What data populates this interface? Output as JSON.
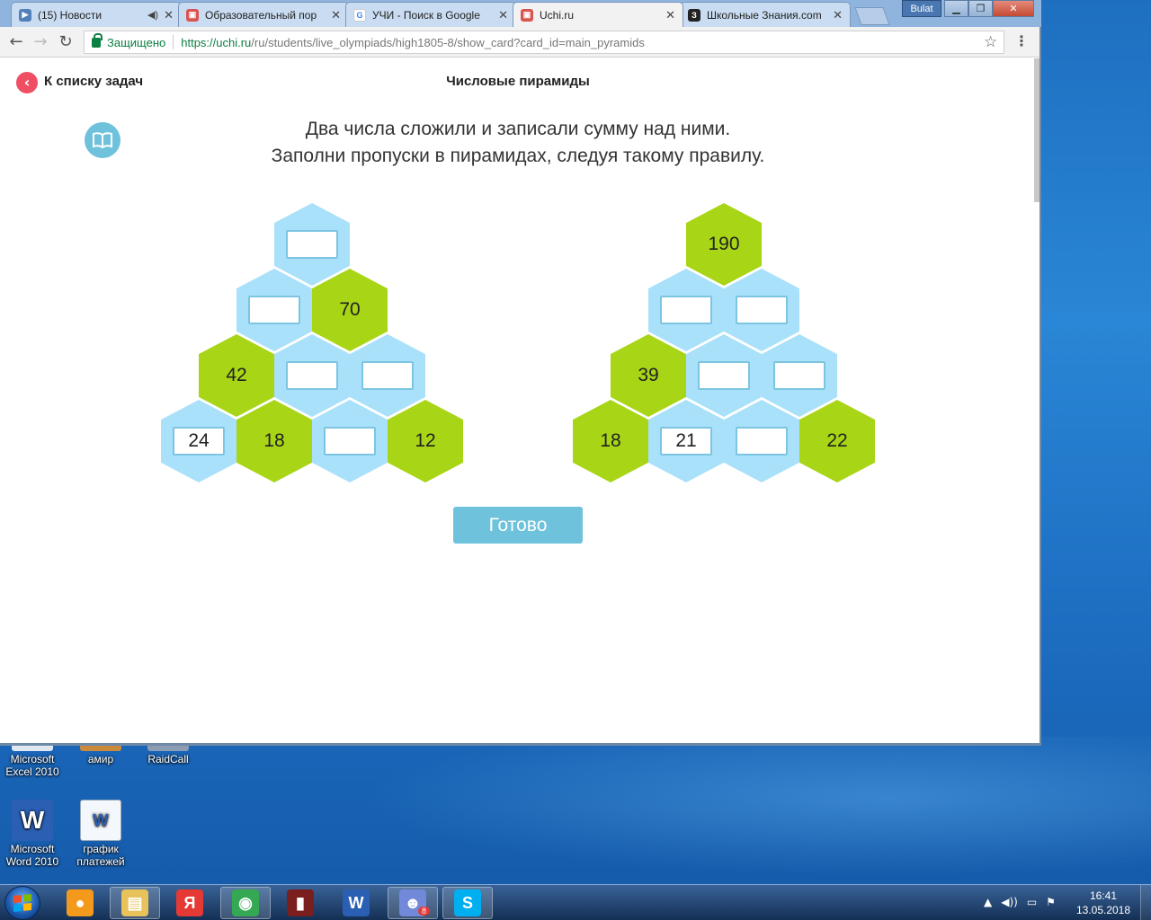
{
  "browser": {
    "tabs": [
      {
        "title": "(15) Новости",
        "favicon_color": "#5181b8",
        "favicon_glyph": "▶"
      },
      {
        "title": "Образовательный пор",
        "favicon_color": "#d9534f",
        "favicon_glyph": "▣"
      },
      {
        "title": "УЧИ - Поиск в Google",
        "favicon_color": "#4285f4",
        "favicon_glyph": "G"
      },
      {
        "title": "Uchi.ru",
        "favicon_color": "#d9534f",
        "favicon_glyph": "▣"
      },
      {
        "title": "Школьные Знания.com",
        "favicon_color": "#222222",
        "favicon_glyph": "З"
      }
    ],
    "user_button": "Bulat",
    "secure_label": "Защищено",
    "url_host": "https://uchi.ru",
    "url_path": "/ru/students/live_olympiads/high1805-8/show_card?card_id=main_pyramids"
  },
  "page": {
    "back_label": "К списку задач",
    "title": "Числовые пирамиды",
    "instruction_line1": "Два числа сложили и записали сумму над ними.",
    "instruction_line2": "Заполни пропуски в пирамидах, следуя такому правилу.",
    "done_button": "Готово"
  },
  "pyramids": [
    {
      "rows": [
        [
          {
            "value": "",
            "kind": "input"
          }
        ],
        [
          {
            "value": "",
            "kind": "input"
          },
          {
            "value": "70",
            "kind": "given"
          }
        ],
        [
          {
            "value": "42",
            "kind": "given"
          },
          {
            "value": "",
            "kind": "input"
          },
          {
            "value": "",
            "kind": "input"
          }
        ],
        [
          {
            "value": "24",
            "kind": "input"
          },
          {
            "value": "18",
            "kind": "given"
          },
          {
            "value": "",
            "kind": "input"
          },
          {
            "value": "12",
            "kind": "given"
          }
        ]
      ]
    },
    {
      "rows": [
        [
          {
            "value": "190",
            "kind": "given"
          }
        ],
        [
          {
            "value": "",
            "kind": "input"
          },
          {
            "value": "",
            "kind": "input"
          }
        ],
        [
          {
            "value": "39",
            "kind": "given"
          },
          {
            "value": "",
            "kind": "input"
          },
          {
            "value": "",
            "kind": "input"
          }
        ],
        [
          {
            "value": "18",
            "kind": "given"
          },
          {
            "value": "21",
            "kind": "input"
          },
          {
            "value": "",
            "kind": "input"
          },
          {
            "value": "22",
            "kind": "given"
          }
        ]
      ]
    }
  ],
  "desktop_icons": [
    {
      "label": "Microsoft Excel 2010",
      "icon": "excel-icon",
      "color": "#1f7a3a"
    },
    {
      "label": "амир",
      "icon": "folder-icon",
      "color": "#c98a3a"
    },
    {
      "label": "RaidCall",
      "icon": "raidcall-icon",
      "color": "#5a6f8a"
    },
    {
      "label": "Microsoft Word 2010",
      "icon": "word-icon",
      "color": "#2b5fb4"
    },
    {
      "label": "график платежей",
      "icon": "word-document-icon",
      "color": "#f4f7fc"
    }
  ],
  "taskbar": {
    "apps": [
      {
        "name": "orange-app-icon",
        "color": "#f39a1c",
        "glyph": "●"
      },
      {
        "name": "file-explorer-icon",
        "color": "#e8c25a",
        "glyph": "▤"
      },
      {
        "name": "yandex-browser-icon",
        "color": "#e53935",
        "glyph": "Я"
      },
      {
        "name": "chrome-icon",
        "color": "#34a853",
        "glyph": "◉"
      },
      {
        "name": "winamp-icon",
        "color": "#7a1e1e",
        "glyph": "▮"
      },
      {
        "name": "word-icon",
        "color": "#2b5fb4",
        "glyph": "W"
      },
      {
        "name": "discord-icon",
        "color": "#7289da",
        "glyph": "☻"
      },
      {
        "name": "skype-icon",
        "color": "#00aff0",
        "glyph": "S"
      }
    ],
    "discord_badge": "8",
    "time": "16:41",
    "date": "13.05.2018"
  }
}
